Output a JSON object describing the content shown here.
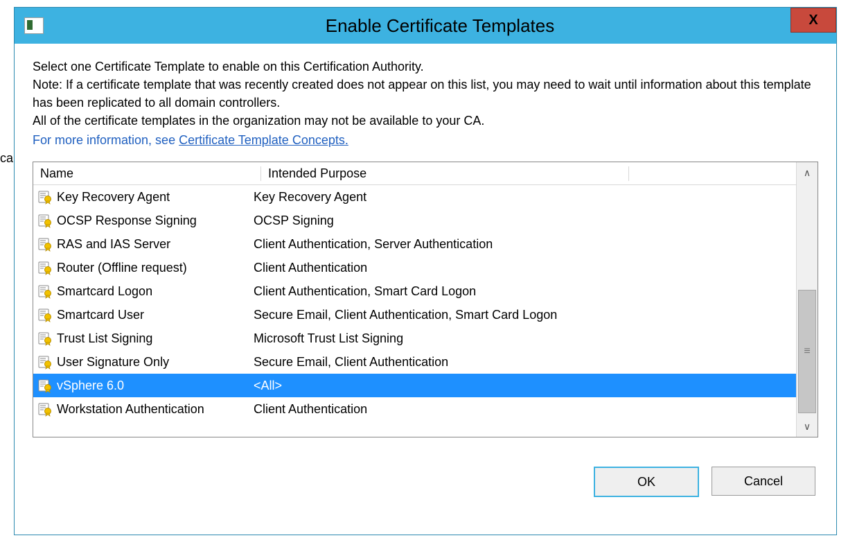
{
  "behind_text": "ca",
  "titlebar": {
    "title": "Enable Certificate Templates",
    "close_glyph": "X"
  },
  "instructions": {
    "line1": "Select one Certificate Template to enable on this Certification Authority.",
    "line2": "Note: If a certificate template that was recently created does not appear on this list, you may need to wait until information about this template has been replicated to all domain controllers.",
    "line3": "All of the certificate templates in the organization may not be available to your CA.",
    "info_prefix": "For more information, see ",
    "info_link": "Certificate Template Concepts."
  },
  "columns": {
    "name": "Name",
    "purpose": "Intended Purpose"
  },
  "rows": [
    {
      "name": "Key Recovery Agent",
      "purpose": "Key Recovery Agent",
      "selected": false
    },
    {
      "name": "OCSP Response Signing",
      "purpose": "OCSP Signing",
      "selected": false
    },
    {
      "name": "RAS and IAS Server",
      "purpose": "Client Authentication, Server Authentication",
      "selected": false
    },
    {
      "name": "Router (Offline request)",
      "purpose": "Client Authentication",
      "selected": false
    },
    {
      "name": "Smartcard Logon",
      "purpose": "Client Authentication, Smart Card Logon",
      "selected": false
    },
    {
      "name": "Smartcard User",
      "purpose": "Secure Email, Client Authentication, Smart Card Logon",
      "selected": false
    },
    {
      "name": "Trust List Signing",
      "purpose": "Microsoft Trust List Signing",
      "selected": false
    },
    {
      "name": "User Signature Only",
      "purpose": "Secure Email, Client Authentication",
      "selected": false
    },
    {
      "name": "vSphere 6.0",
      "purpose": "<All>",
      "selected": true
    },
    {
      "name": "Workstation Authentication",
      "purpose": "Client Authentication",
      "selected": false
    }
  ],
  "buttons": {
    "ok": "OK",
    "cancel": "Cancel"
  },
  "icons": {
    "certificate": "certificate-icon"
  }
}
